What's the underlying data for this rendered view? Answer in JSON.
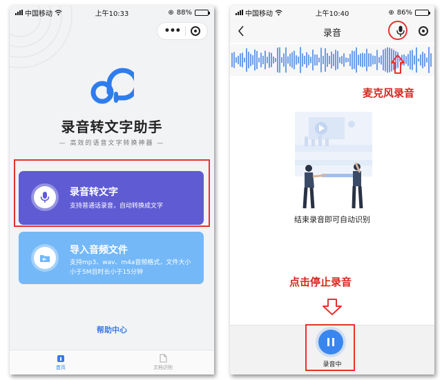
{
  "left_screen": {
    "statusbar": {
      "carrier": "中国移动",
      "time": "上午10:33",
      "battery": "88%",
      "battery_level": 0.88
    },
    "capsule": {
      "more_icon": "more-dots-icon",
      "close_icon": "target-close-icon"
    },
    "logo_icon": "audio-wave-logo",
    "app_title": "录音转文字助手",
    "app_subtitle": "— 高效的语音文字转换神器 —",
    "cards": [
      {
        "title": "录音转文字",
        "desc": "支持普通话录音，自动转换成文字",
        "icon": "microphone-icon",
        "color": "#5f5bd3"
      },
      {
        "title": "导入音频文件",
        "desc": "支持mp3、wav、m4a音频格式，文件大小小于5M且时长小于15分钟",
        "icon": "folder-icon",
        "color": "#74b8f8"
      }
    ],
    "help_link": "帮助中心",
    "tabs": [
      {
        "label": "首页",
        "icon": "home-icon",
        "active": true
      },
      {
        "label": "文档识别",
        "icon": "document-icon",
        "active": false
      }
    ]
  },
  "right_screen": {
    "statusbar": {
      "carrier": "中国移动",
      "time": "上午10:40",
      "battery": "86%",
      "battery_level": 0.86
    },
    "nav_title": "录音",
    "annotation_mic": "麦克风录音",
    "illustration_caption": "结束录音即可自动识别",
    "annotation_stop": "点击停止录音",
    "recording_label": "录音中",
    "colors": {
      "accent": "#3a86f0",
      "annotation": "#d9251c"
    }
  }
}
